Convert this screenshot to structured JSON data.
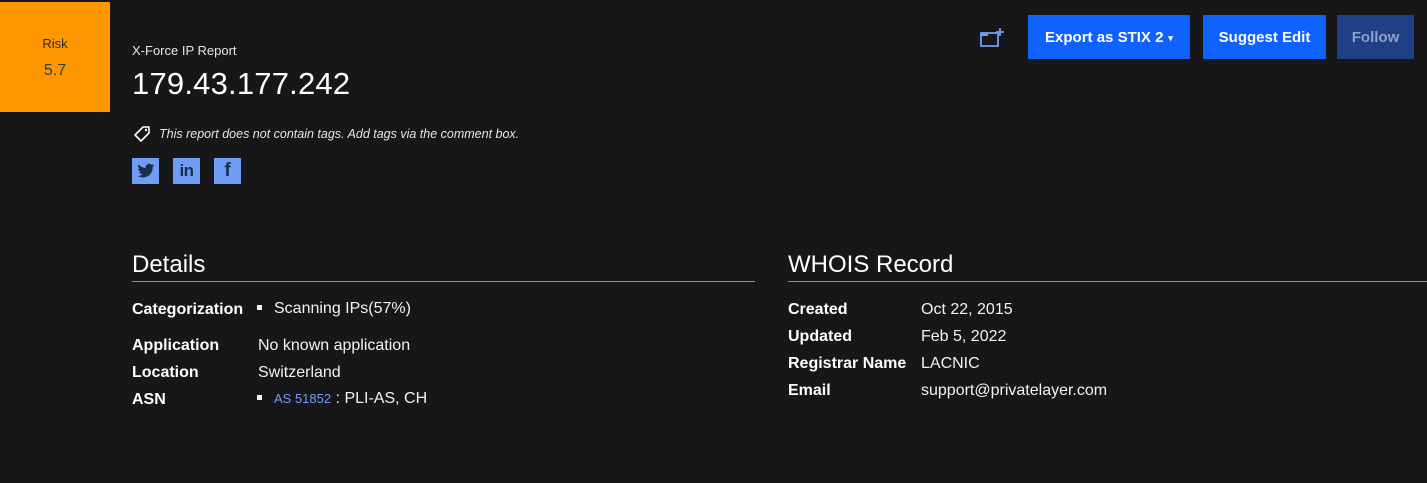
{
  "risk": {
    "label": "Risk",
    "score": "5.7",
    "color": "#ff9800"
  },
  "header": {
    "report_type": "X-Force IP Report",
    "ip": "179.43.177.242",
    "tags_note": "This report does not contain tags. Add tags via the comment box.",
    "tag_icon": "tag-icon"
  },
  "social": [
    {
      "name": "twitter",
      "icon": "twitter-icon"
    },
    {
      "name": "linkedin",
      "icon": "linkedin-icon",
      "glyph": "in"
    },
    {
      "name": "facebook",
      "icon": "facebook-icon",
      "glyph": "f"
    }
  ],
  "toolbar": {
    "add_icon": "add-to-collection-icon",
    "export_label": "Export as STIX 2",
    "export_caret": "▾",
    "suggest_label": "Suggest Edit",
    "follow_label": "Follow",
    "primary_color": "#0f62fe"
  },
  "details": {
    "title": "Details",
    "categorization_label": "Categorization",
    "categorization_value": "Scanning IPs(57%)",
    "application_label": "Application",
    "application_value": "No known application",
    "location_label": "Location",
    "location_value": "Switzerland",
    "asn_label": "ASN",
    "asn_link": "AS 51852",
    "asn_suffix": " : PLI-AS, CH"
  },
  "whois": {
    "title": "WHOIS Record",
    "created_label": "Created",
    "created_value": "Oct 22, 2015",
    "updated_label": "Updated",
    "updated_value": "Feb 5, 2022",
    "registrar_label": "Registrar Name",
    "registrar_value": "LACNIC",
    "email_label": "Email",
    "email_value": "support@privatelayer.com"
  }
}
